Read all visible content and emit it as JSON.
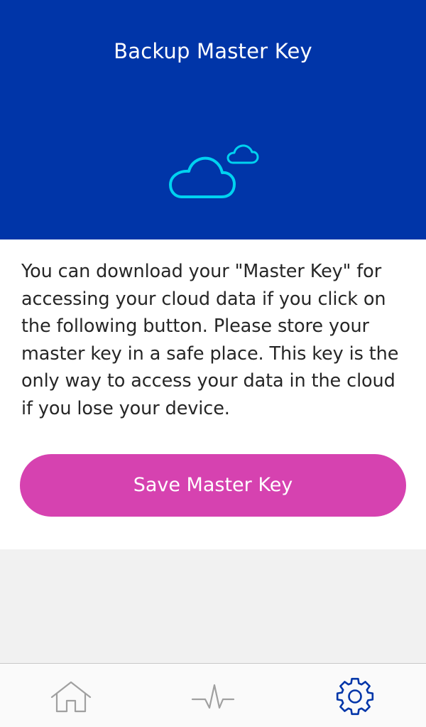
{
  "header": {
    "title": "Backup Master Key",
    "icon": "cloud-icon",
    "background_color": "#0035a8",
    "icon_color": "#00d2f0"
  },
  "content": {
    "description": "You can download your \"Master Key\" for accessing your cloud data if you click on the following button. Please store your master key in a safe place. This key is the only way to access your data in the cloud if you lose your device.",
    "save_button_label": "Save Master Key",
    "button_color": "#d642b0"
  },
  "tabbar": {
    "tabs": [
      {
        "icon": "home-icon",
        "active": false
      },
      {
        "icon": "activity-icon",
        "active": false
      },
      {
        "icon": "gear-icon",
        "active": true
      }
    ],
    "active_color": "#0035a8",
    "inactive_color": "#a0a0a0"
  }
}
